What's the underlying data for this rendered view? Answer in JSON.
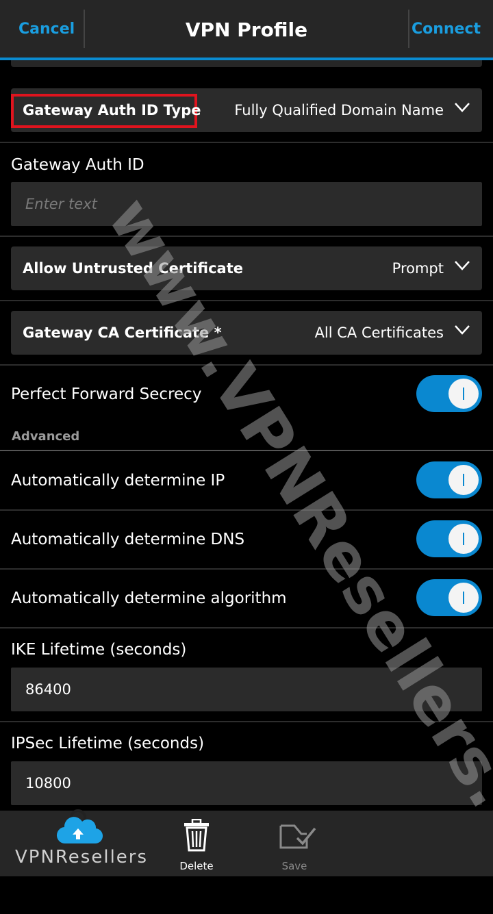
{
  "titlebar": {
    "cancel_label": "Cancel",
    "title": "VPN Profile",
    "connect_label": "Connect"
  },
  "fields": {
    "gateway_auth_id_type": {
      "label": "Gateway Auth ID Type",
      "value": "Fully Qualified Domain Name"
    },
    "gateway_auth_id": {
      "label": "Gateway Auth ID",
      "placeholder": "Enter text",
      "value": ""
    },
    "allow_untrusted_cert": {
      "label": "Allow Untrusted Certificate",
      "value": "Prompt"
    },
    "gateway_ca_cert": {
      "label": "Gateway CA Certificate *",
      "value": "All CA Certificates"
    },
    "perfect_forward_secrecy": {
      "label": "Perfect Forward Secrecy",
      "on": true
    }
  },
  "advanced": {
    "header": "Advanced",
    "auto_ip": {
      "label": "Automatically determine IP",
      "on": true
    },
    "auto_dns": {
      "label": "Automatically determine DNS",
      "on": true
    },
    "auto_algorithm": {
      "label": "Automatically determine algorithm",
      "on": true
    },
    "ike_lifetime": {
      "label": "IKE Lifetime (seconds)",
      "value": "86400"
    },
    "ipsec_lifetime": {
      "label": "IPSec Lifetime (seconds)",
      "value": "10800"
    }
  },
  "actionbar": {
    "delete_label": "Delete",
    "save_label": "Save"
  },
  "watermark": "www.VPNResellers.me",
  "logo_text": "VPNResellers",
  "colors": {
    "accent": "#0a88d0",
    "highlight": "#e0141e"
  }
}
